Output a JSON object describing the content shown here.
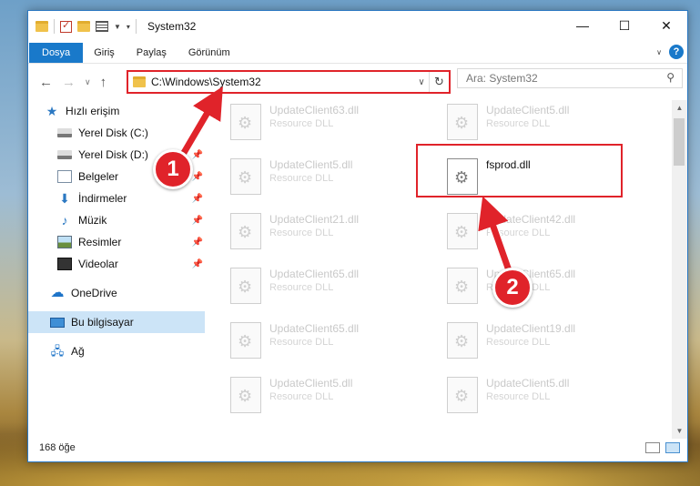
{
  "window": {
    "title": "System32",
    "controls": {
      "minimize": "—",
      "maximize": "☐",
      "close": "✕"
    }
  },
  "ribbon": {
    "tabs": [
      "Dosya",
      "Giriş",
      "Paylaş",
      "Görünüm"
    ],
    "help": "?"
  },
  "address": {
    "path": "C:\\Windows\\System32",
    "search_placeholder": "Ara: System32"
  },
  "sidebar": {
    "items": [
      {
        "label": "Hızlı erişim",
        "icon": "star-icon"
      },
      {
        "label": "Yerel Disk (C:)",
        "icon": "drive-icon",
        "pinned": true
      },
      {
        "label": "Yerel Disk (D:)",
        "icon": "drive-icon",
        "pinned": true
      },
      {
        "label": "Belgeler",
        "icon": "documents-icon",
        "pinned": true
      },
      {
        "label": "İndirmeler",
        "icon": "download-icon",
        "pinned": true
      },
      {
        "label": "Müzik",
        "icon": "music-icon",
        "pinned": true
      },
      {
        "label": "Resimler",
        "icon": "pictures-icon",
        "pinned": true
      },
      {
        "label": "Videolar",
        "icon": "videos-icon",
        "pinned": true
      },
      {
        "label": "OneDrive",
        "icon": "onedrive-icon"
      },
      {
        "label": "Bu bilgisayar",
        "icon": "computer-icon",
        "selected": true
      },
      {
        "label": "Ağ",
        "icon": "network-icon"
      }
    ]
  },
  "files": [
    {
      "name": "UpdateClient63.dll",
      "desc": "Resource DLL"
    },
    {
      "name": "UpdateClient5.dll",
      "desc": "Resource DLL"
    },
    {
      "name": "UpdateClient5.dll",
      "desc": "Resource DLL"
    },
    {
      "name": "fsprod.dll",
      "desc": "",
      "highlighted": true
    },
    {
      "name": "UpdateClient21.dll",
      "desc": "Resource DLL"
    },
    {
      "name": "UpdateClient42.dll",
      "desc": "Resource DLL"
    },
    {
      "name": "UpdateClient65.dll",
      "desc": "Resource DLL"
    },
    {
      "name": "UpdateClient65.dll",
      "desc": "Resource DLL"
    },
    {
      "name": "UpdateClient65.dll",
      "desc": "Resource DLL"
    },
    {
      "name": "UpdateClient19.dll",
      "desc": "Resource DLL"
    },
    {
      "name": "UpdateClient5.dll",
      "desc": "Resource DLL"
    },
    {
      "name": "UpdateClient5.dll",
      "desc": "Resource DLL"
    }
  ],
  "status": {
    "count": "168 öğe"
  },
  "annotations": {
    "step1": "1",
    "step2": "2",
    "color": "#e0232a"
  }
}
